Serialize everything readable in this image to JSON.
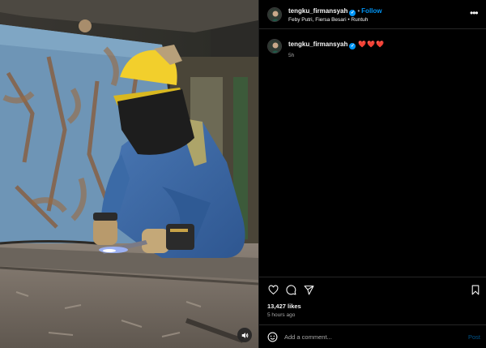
{
  "post": {
    "username": "tengku_firmansyah",
    "verified_mark": "✓",
    "separator": "•",
    "follow_label": "Follow",
    "audio": "Feby Putri, Fiersa Besari • Runtuh",
    "more_label": "•••"
  },
  "caption": {
    "username": "tengku_firmansyah",
    "text": "❤️❤️❤️",
    "time": "5h"
  },
  "stats": {
    "likes": "13,427 likes",
    "posted": "5 hours ago"
  },
  "comment": {
    "placeholder": "Add a comment...",
    "post_label": "Post"
  },
  "icons": {
    "like": "heart-icon",
    "comment": "comment-icon",
    "share": "share-icon",
    "save": "bookmark-icon",
    "emoji": "emoji-icon",
    "mute": "speaker-icon"
  },
  "colors": {
    "accent": "#0095f6",
    "heart": "#ed4956",
    "background": "#000000",
    "secondary_text": "#a8a8a8"
  }
}
